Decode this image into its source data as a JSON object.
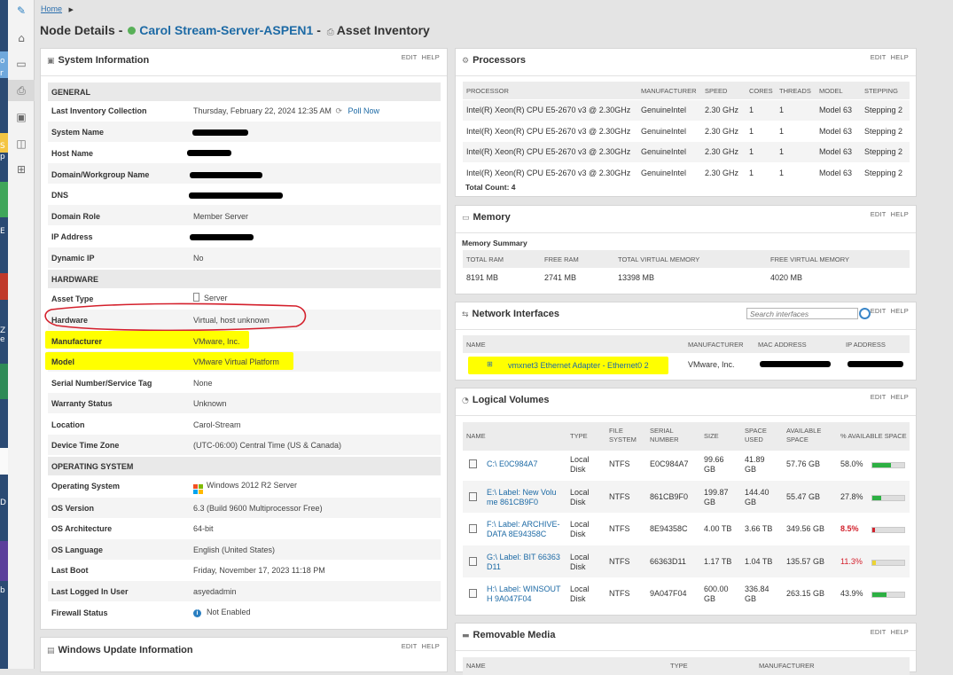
{
  "colors": {
    "link": "#1d6aa5",
    "green": "#2db043",
    "red": "#d2222d",
    "yellow": "#ecd432",
    "highlight": "#ffff00",
    "annotation": "#d4202c"
  },
  "desktop_strip": [
    "o",
    "r",
    "S",
    "p",
    "E",
    "Z",
    "e",
    "D",
    "b"
  ],
  "nav_icons": [
    "pencil-icon",
    "home-icon",
    "report-icon",
    "printer-icon",
    "network-map-icon",
    "map-icon",
    "dashboard-icon",
    "hierarchy-icon"
  ],
  "breadcrumb": {
    "home": "Home"
  },
  "title": {
    "prefix": "Node Details - ",
    "node": "Carol Stream-Server-ASPEN1",
    "sep": " - ",
    "page": "Asset Inventory"
  },
  "edit": "EDIT",
  "help": "HELP",
  "sysinfo": {
    "title": "System Information",
    "general": "GENERAL",
    "last_inv_label": "Last Inventory Collection",
    "last_inv_value": "Thursday, February 22, 2024 12:35 AM",
    "poll_now": "Poll Now",
    "system_name": "System Name",
    "host_name": "Host Name",
    "domain": "Domain/Workgroup Name",
    "dns": "DNS",
    "domain_role_label": "Domain Role",
    "domain_role_value": "Member Server",
    "ip": "IP Address",
    "dyn_ip_label": "Dynamic IP",
    "dyn_ip_value": "No",
    "hardware": "HARDWARE",
    "asset_type_label": "Asset Type",
    "asset_type_value": "Server",
    "hw_label": "Hardware",
    "hw_value": "Virtual, host unknown",
    "mfr_label": "Manufacturer",
    "mfr_value": "VMware, Inc.",
    "model_label": "Model",
    "model_value": "VMware Virtual Platform",
    "serial_label": "Serial Number/Service Tag",
    "serial_value": "None",
    "warranty_label": "Warranty Status",
    "warranty_value": "Unknown",
    "location_label": "Location",
    "location_value": "Carol-Stream",
    "tz_label": "Device Time Zone",
    "tz_value": "(UTC-06:00) Central Time (US & Canada)",
    "os_section": "OPERATING SYSTEM",
    "os_label": "Operating System",
    "os_value": "Windows 2012 R2 Server",
    "osver_label": "OS Version",
    "osver_value": "6.3 (Build 9600 Multiprocessor Free)",
    "osarch_label": "OS Architecture",
    "osarch_value": "64-bit",
    "oslang_label": "OS Language",
    "oslang_value": "English (United States)",
    "boot_label": "Last Boot",
    "boot_value": "Friday, November 17, 2023 11:18 PM",
    "user_label": "Last Logged In User",
    "user_value": "asyedadmin",
    "fw_label": "Firewall Status",
    "fw_value": "Not Enabled"
  },
  "winupdate": {
    "title": "Windows Update Information"
  },
  "processors": {
    "title": "Processors",
    "headers": [
      "PROCESSOR",
      "MANUFACTURER",
      "SPEED",
      "CORES",
      "THREADS",
      "MODEL",
      "STEPPING"
    ],
    "rows": [
      [
        "Intel(R) Xeon(R) CPU E5-2670 v3 @ 2.30GHz",
        "GenuineIntel",
        "2.30 GHz",
        "1",
        "1",
        "Model 63",
        "Stepping 2"
      ],
      [
        "Intel(R) Xeon(R) CPU E5-2670 v3 @ 2.30GHz",
        "GenuineIntel",
        "2.30 GHz",
        "1",
        "1",
        "Model 63",
        "Stepping 2"
      ],
      [
        "Intel(R) Xeon(R) CPU E5-2670 v3 @ 2.30GHz",
        "GenuineIntel",
        "2.30 GHz",
        "1",
        "1",
        "Model 63",
        "Stepping 2"
      ],
      [
        "Intel(R) Xeon(R) CPU E5-2670 v3 @ 2.30GHz",
        "GenuineIntel",
        "2.30 GHz",
        "1",
        "1",
        "Model 63",
        "Stepping 2"
      ]
    ],
    "total": "Total Count: 4"
  },
  "memory": {
    "title": "Memory",
    "summary": "Memory Summary",
    "headers": [
      "TOTAL RAM",
      "FREE RAM",
      "TOTAL VIRTUAL MEMORY",
      "FREE VIRTUAL MEMORY"
    ],
    "values": [
      "8191 MB",
      "2741 MB",
      "13398 MB",
      "4020 MB"
    ]
  },
  "network": {
    "title": "Network Interfaces",
    "search_placeholder": "Search interfaces",
    "headers": [
      "NAME",
      "MANUFACTURER",
      "MAC ADDRESS",
      "IP ADDRESS"
    ],
    "row": {
      "name": "vmxnet3 Ethernet Adapter - Ethernet0 2",
      "mfr": "VMware, Inc."
    }
  },
  "volumes": {
    "title": "Logical Volumes",
    "headers": {
      "name": "NAME",
      "type": "TYPE",
      "fs": "FILE SYSTEM",
      "serial": "SERIAL NUMBER",
      "size": "SIZE",
      "used": "SPACE USED",
      "avail": "AVAILABLE SPACE",
      "pct": "% AVAILABLE SPACE"
    },
    "rows": [
      {
        "name": "C:\\ E0C984A7",
        "type": "Local Disk",
        "fs": "NTFS",
        "serial": "E0C984A7",
        "size": "99.66 GB",
        "used": "41.89 GB",
        "avail": "57.76 GB",
        "pct": "58.0%",
        "fraction": 0.58,
        "status": "ok"
      },
      {
        "name": "E:\\ Label: New Volume 861CB9F0",
        "type": "Local Disk",
        "fs": "NTFS",
        "serial": "861CB9F0",
        "size": "199.87 GB",
        "used": "144.40 GB",
        "avail": "55.47 GB",
        "pct": "27.8%",
        "fraction": 0.278,
        "status": "ok"
      },
      {
        "name": "F:\\ Label: ARCHIVE-DATA 8E94358C",
        "type": "Local Disk",
        "fs": "NTFS",
        "serial": "8E94358C",
        "size": "4.00 TB",
        "used": "3.66 TB",
        "avail": "349.56 GB",
        "pct": "8.5%",
        "fraction": 0.085,
        "status": "critical"
      },
      {
        "name": "G:\\ Label: BIT 66363D11",
        "type": "Local Disk",
        "fs": "NTFS",
        "serial": "66363D11",
        "size": "1.17 TB",
        "used": "1.04 TB",
        "avail": "135.57 GB",
        "pct": "11.3%",
        "fraction": 0.113,
        "status": "warning"
      },
      {
        "name": "H:\\ Label: WINSOUTH 9A047F04",
        "type": "Local Disk",
        "fs": "NTFS",
        "serial": "9A047F04",
        "size": "600.00 GB",
        "used": "336.84 GB",
        "avail": "263.15 GB",
        "pct": "43.9%",
        "fraction": 0.439,
        "status": "ok"
      }
    ]
  },
  "removable": {
    "title": "Removable Media",
    "headers": [
      "NAME",
      "TYPE",
      "MANUFACTURER"
    ]
  }
}
